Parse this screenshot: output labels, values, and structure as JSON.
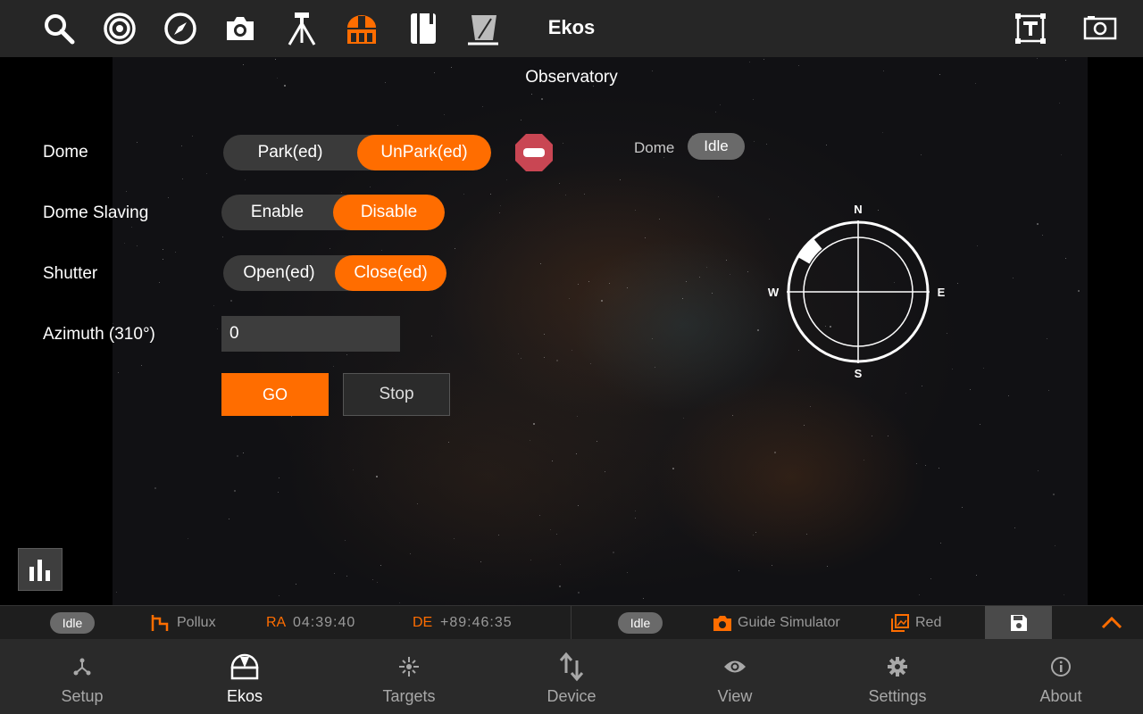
{
  "app": {
    "title": "Ekos"
  },
  "toolbar": {
    "icons": [
      "search-icon",
      "target-icon",
      "compass-icon",
      "camera-icon",
      "tripod-icon",
      "observatory-dome-icon",
      "notebook-icon",
      "flat-panel-icon"
    ],
    "right_icons": [
      "text-frame-icon",
      "screen-capture-icon"
    ],
    "accent": "#ff6d00"
  },
  "main": {
    "title": "Observatory",
    "dome": {
      "label": "Dome",
      "park_label": "Park(ed)",
      "unpark_label": "UnPark(ed)",
      "active": "UnPark(ed)",
      "status_label": "Dome",
      "status_value": "Idle"
    },
    "slaving": {
      "label": "Dome Slaving",
      "enable_label": "Enable",
      "disable_label": "Disable",
      "active": "Disable"
    },
    "shutter": {
      "label": "Shutter",
      "open_label": "Open(ed)",
      "close_label": "Close(ed)",
      "active": "Close(ed)"
    },
    "azimuth": {
      "label": "Azimuth (310°)",
      "value": "0"
    },
    "go_label": "GO",
    "stop_label": "Stop",
    "compass": {
      "n": "N",
      "s": "S",
      "e": "E",
      "w": "W",
      "dome_azimuth_deg": 310
    }
  },
  "statusbar": {
    "left": {
      "status": "Idle",
      "target": "Pollux",
      "ra_label": "RA",
      "ra_value": "04:39:40",
      "de_label": "DE",
      "de_value": "+89:46:35"
    },
    "right": {
      "status": "Idle",
      "camera": "Guide Simulator",
      "filter": "Red"
    }
  },
  "nav": {
    "items": [
      {
        "label": "Setup",
        "icon": "setup-nodes-icon"
      },
      {
        "label": "Ekos",
        "icon": "dome-icon",
        "active": true
      },
      {
        "label": "Targets",
        "icon": "targets-icon"
      },
      {
        "label": "Device",
        "icon": "device-arrows-icon"
      },
      {
        "label": "View",
        "icon": "eye-icon"
      },
      {
        "label": "Settings",
        "icon": "gear-icon"
      },
      {
        "label": "About",
        "icon": "info-icon"
      }
    ]
  }
}
